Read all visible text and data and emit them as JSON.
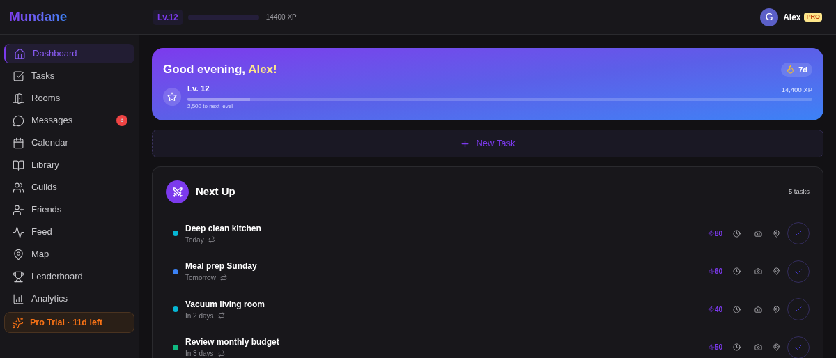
{
  "brand": "Mundane",
  "topbar": {
    "level_badge": "Lv.12",
    "xp": "14400 XP",
    "user": {
      "avatar": "G",
      "name": "Alex",
      "badge": "PRO"
    }
  },
  "sidebar": {
    "items": [
      {
        "label": "Dashboard",
        "selected": true
      },
      {
        "label": "Tasks",
        "selected": false
      },
      {
        "label": "Rooms",
        "selected": false
      },
      {
        "label": "Messages",
        "selected": false,
        "badge": "3"
      },
      {
        "label": "Calendar",
        "selected": false
      },
      {
        "label": "Library",
        "selected": false
      },
      {
        "label": "Guilds",
        "selected": false
      },
      {
        "label": "Friends",
        "selected": false
      },
      {
        "label": "Feed",
        "selected": false
      },
      {
        "label": "Map",
        "selected": false
      },
      {
        "label": "Leaderboard",
        "selected": false
      },
      {
        "label": "Analytics",
        "selected": false
      }
    ],
    "trial": "Pro Trial · 11d left"
  },
  "hero": {
    "greeting": "Good evening, ",
    "name": "Alex!",
    "streak": "7d",
    "level_label": "Lv. 12",
    "xp": "14,400 XP",
    "progress": {
      "level": 0.1
    },
    "next_level": "2,500 to next level"
  },
  "new_task": "New Task",
  "next_up": {
    "title": "Next Up",
    "count": "5 tasks",
    "tasks": [
      {
        "title": "Deep clean kitchen",
        "due": "Today",
        "color": "#06b6d4",
        "points": "80"
      },
      {
        "title": "Meal prep Sunday",
        "due": "Tomorrow",
        "color": "#3b82f6",
        "points": "60"
      },
      {
        "title": "Vacuum living room",
        "due": "In 2 days",
        "color": "#06b6d4",
        "points": "40"
      },
      {
        "title": "Review monthly budget",
        "due": "In 3 days",
        "color": "#10b981",
        "points": "50"
      }
    ]
  }
}
